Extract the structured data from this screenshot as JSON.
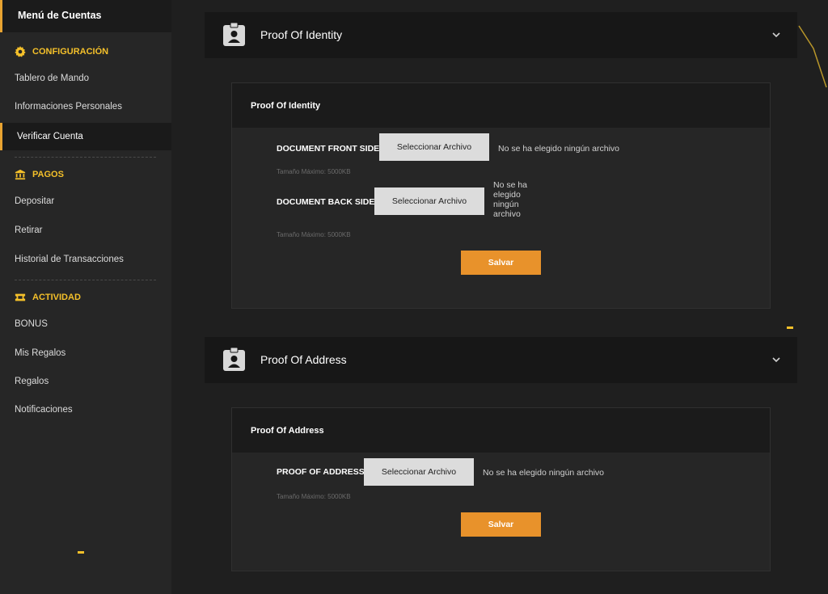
{
  "sidebar": {
    "title": "Menú de Cuentas",
    "sections": {
      "config": "CONFIGURACIÓN",
      "pagos": "PAGOS",
      "actividad": "ACTIVIDAD"
    },
    "items": {
      "tablero": "Tablero de Mando",
      "info": "Informaciones Personales",
      "verificar": "Verificar Cuenta",
      "depositar": "Depositar",
      "retirar": "Retirar",
      "historial": "Historial de Transacciones",
      "bonus": "BONUS",
      "misregalos": "Mis Regalos",
      "regalos": "Regalos",
      "notificaciones": "Notificaciones"
    },
    "accent_color": "#f4c02a"
  },
  "identity": {
    "header_title": "Proof Of Identity",
    "card_title": "Proof Of Identity",
    "front_label": "DOCUMENT FRONT SIDE",
    "front_button": "Seleccionar Archivo",
    "front_status": "No se ha elegido ningún archivo",
    "front_hint": "Tamaño Máximo: 5000KB",
    "back_label": "DOCUMENT BACK SIDE",
    "back_button": "Seleccionar Archivo",
    "back_status": "No se ha elegido ningún archivo",
    "back_hint": "Tamaño Máximo: 5000KB",
    "save": "Salvar"
  },
  "address": {
    "header_title": "Proof Of Address",
    "card_title": "Proof Of Address",
    "proof_label": "PROOF OF ADDRESS",
    "proof_button": "Seleccionar Archivo",
    "proof_status": "No se ha elegido ningún archivo",
    "proof_hint": "Tamaño Máximo: 5000KB",
    "save": "Salvar"
  },
  "icons": {
    "gear": "gear-icon",
    "bank": "bank-icon",
    "ticket": "ticket-icon",
    "badge": "id-badge-icon",
    "chevron": "chevron-down-icon"
  },
  "colors": {
    "save_button": "#e8922b",
    "active_border": "#e8a331"
  }
}
